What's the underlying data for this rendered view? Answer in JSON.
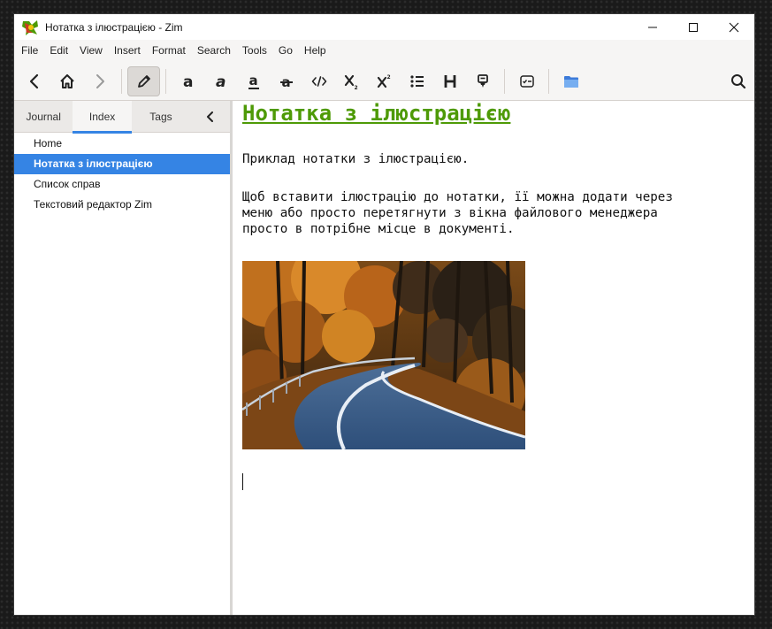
{
  "window": {
    "title": "Нотатка з ілюстрацією - Zim",
    "app_icon": "zim-app-icon"
  },
  "menubar": [
    "File",
    "Edit",
    "View",
    "Insert",
    "Format",
    "Search",
    "Tools",
    "Go",
    "Help"
  ],
  "toolbar": {
    "buttons": [
      "back-icon",
      "home-icon",
      "forward-icon",
      "edit-pencil-icon",
      "bold-icon",
      "italic-icon",
      "underline-icon",
      "strikethrough-icon",
      "code-icon",
      "subscript-icon",
      "superscript-icon",
      "bullet-list-icon",
      "heading-icon",
      "highlight-marker-icon",
      "checkbox-list-icon",
      "folder-icon",
      "search-icon"
    ],
    "active": "edit-pencil-icon",
    "accent": "#3584e4"
  },
  "sidebar": {
    "tabs": [
      {
        "label": "Journal"
      },
      {
        "label": "Index"
      },
      {
        "label": "Tags"
      }
    ],
    "active_tab": "Index",
    "items": [
      {
        "label": "Home"
      },
      {
        "label": "Нотатка з ілюстрацією"
      },
      {
        "label": "Список справ"
      },
      {
        "label": "Текстовий редактор Zim"
      }
    ],
    "selected_item": "Нотатка з ілюстрацією"
  },
  "editor": {
    "title": "Нотатка з ілюстрацією",
    "title_color": "#4e9a06",
    "paragraph1": "Приклад нотатки з ілюстрацією.",
    "paragraph2": "Щоб вставити ілюстрацію до нотатки, її можна додати через\nменю або просто перетягнути з вікна файлового менеджера\nпросто в потрібне місце в документі.",
    "image": "autumn-road-photo"
  }
}
